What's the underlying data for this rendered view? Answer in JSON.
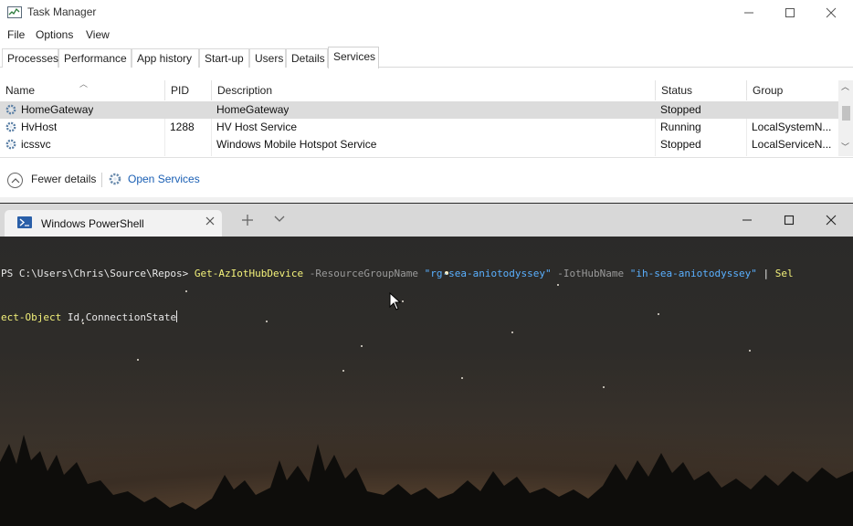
{
  "task_manager": {
    "title": "Task Manager",
    "menu": [
      "File",
      "Options",
      "View"
    ],
    "tabs": [
      "Processes",
      "Performance",
      "App history",
      "Start-up",
      "Users",
      "Details",
      "Services"
    ],
    "active_tab": "Services",
    "columns": [
      "Name",
      "PID",
      "Description",
      "Status",
      "Group"
    ],
    "rows": [
      {
        "name": "HomeGateway",
        "pid": "",
        "description": "HomeGateway",
        "status": "Stopped",
        "group": "",
        "selected": true
      },
      {
        "name": "HvHost",
        "pid": "1288",
        "description": "HV Host Service",
        "status": "Running",
        "group": "LocalSystemN...",
        "selected": false
      },
      {
        "name": "icssvc",
        "pid": "",
        "description": "Windows Mobile Hotspot Service",
        "status": "Stopped",
        "group": "LocalServiceN...",
        "selected": false
      }
    ],
    "footer": {
      "fewer_details": "Fewer details",
      "open_services": "Open Services"
    }
  },
  "powershell": {
    "tab_label": "Windows PowerShell",
    "line1": {
      "prompt": "PS C:\\Users\\Chris\\Source\\Repos> ",
      "cmd": "Get-AzIotHubDevice",
      "p1": " -ResourceGroupName ",
      "s1": "\"rg-sea-aniotodyssey\"",
      "p2": " -IotHubName ",
      "s2": "\"ih-sea-aniotodyssey\"",
      "pipe": " | ",
      "cmd2a": "Sel"
    },
    "line2": {
      "cmd2b": "ect-Object",
      "args": " Id,ConnectionState"
    }
  },
  "colors": {
    "accent_link": "#1a5fb4",
    "ps_cmd": "#f3f17a",
    "ps_string": "#5ab0ff",
    "ps_param": "#9a9a9a",
    "selected_row": "#dcdcdc"
  }
}
